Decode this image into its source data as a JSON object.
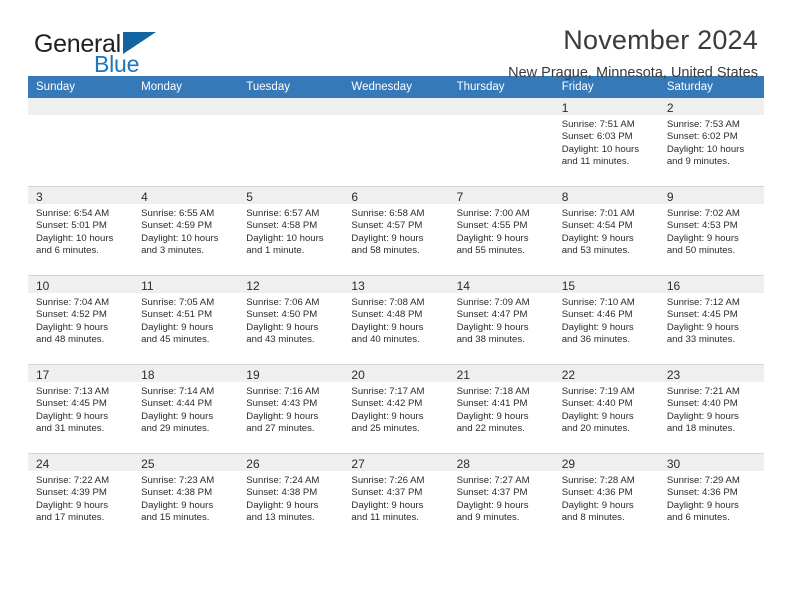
{
  "brand": {
    "name_top": "General",
    "name_bottom": "Blue",
    "accent_color": "#1b76bc",
    "triangle_color": "#12659f"
  },
  "header": {
    "title": "November 2024",
    "subtitle": "New Prague, Minnesota, United States",
    "header_bg": "#3579b9",
    "daystrip_bg": "#efefef"
  },
  "weekday_headers": [
    "Sunday",
    "Monday",
    "Tuesday",
    "Wednesday",
    "Thursday",
    "Friday",
    "Saturday"
  ],
  "weeks": [
    [
      {
        "day": "",
        "sunrise": "",
        "sunset": "",
        "daylight_1": "",
        "daylight_2": ""
      },
      {
        "day": "",
        "sunrise": "",
        "sunset": "",
        "daylight_1": "",
        "daylight_2": ""
      },
      {
        "day": "",
        "sunrise": "",
        "sunset": "",
        "daylight_1": "",
        "daylight_2": ""
      },
      {
        "day": "",
        "sunrise": "",
        "sunset": "",
        "daylight_1": "",
        "daylight_2": ""
      },
      {
        "day": "",
        "sunrise": "",
        "sunset": "",
        "daylight_1": "",
        "daylight_2": ""
      },
      {
        "day": "1",
        "sunrise": "Sunrise: 7:51 AM",
        "sunset": "Sunset: 6:03 PM",
        "daylight_1": "Daylight: 10 hours",
        "daylight_2": "and 11 minutes."
      },
      {
        "day": "2",
        "sunrise": "Sunrise: 7:53 AM",
        "sunset": "Sunset: 6:02 PM",
        "daylight_1": "Daylight: 10 hours",
        "daylight_2": "and 9 minutes."
      }
    ],
    [
      {
        "day": "3",
        "sunrise": "Sunrise: 6:54 AM",
        "sunset": "Sunset: 5:01 PM",
        "daylight_1": "Daylight: 10 hours",
        "daylight_2": "and 6 minutes."
      },
      {
        "day": "4",
        "sunrise": "Sunrise: 6:55 AM",
        "sunset": "Sunset: 4:59 PM",
        "daylight_1": "Daylight: 10 hours",
        "daylight_2": "and 3 minutes."
      },
      {
        "day": "5",
        "sunrise": "Sunrise: 6:57 AM",
        "sunset": "Sunset: 4:58 PM",
        "daylight_1": "Daylight: 10 hours",
        "daylight_2": "and 1 minute."
      },
      {
        "day": "6",
        "sunrise": "Sunrise: 6:58 AM",
        "sunset": "Sunset: 4:57 PM",
        "daylight_1": "Daylight: 9 hours",
        "daylight_2": "and 58 minutes."
      },
      {
        "day": "7",
        "sunrise": "Sunrise: 7:00 AM",
        "sunset": "Sunset: 4:55 PM",
        "daylight_1": "Daylight: 9 hours",
        "daylight_2": "and 55 minutes."
      },
      {
        "day": "8",
        "sunrise": "Sunrise: 7:01 AM",
        "sunset": "Sunset: 4:54 PM",
        "daylight_1": "Daylight: 9 hours",
        "daylight_2": "and 53 minutes."
      },
      {
        "day": "9",
        "sunrise": "Sunrise: 7:02 AM",
        "sunset": "Sunset: 4:53 PM",
        "daylight_1": "Daylight: 9 hours",
        "daylight_2": "and 50 minutes."
      }
    ],
    [
      {
        "day": "10",
        "sunrise": "Sunrise: 7:04 AM",
        "sunset": "Sunset: 4:52 PM",
        "daylight_1": "Daylight: 9 hours",
        "daylight_2": "and 48 minutes."
      },
      {
        "day": "11",
        "sunrise": "Sunrise: 7:05 AM",
        "sunset": "Sunset: 4:51 PM",
        "daylight_1": "Daylight: 9 hours",
        "daylight_2": "and 45 minutes."
      },
      {
        "day": "12",
        "sunrise": "Sunrise: 7:06 AM",
        "sunset": "Sunset: 4:50 PM",
        "daylight_1": "Daylight: 9 hours",
        "daylight_2": "and 43 minutes."
      },
      {
        "day": "13",
        "sunrise": "Sunrise: 7:08 AM",
        "sunset": "Sunset: 4:48 PM",
        "daylight_1": "Daylight: 9 hours",
        "daylight_2": "and 40 minutes."
      },
      {
        "day": "14",
        "sunrise": "Sunrise: 7:09 AM",
        "sunset": "Sunset: 4:47 PM",
        "daylight_1": "Daylight: 9 hours",
        "daylight_2": "and 38 minutes."
      },
      {
        "day": "15",
        "sunrise": "Sunrise: 7:10 AM",
        "sunset": "Sunset: 4:46 PM",
        "daylight_1": "Daylight: 9 hours",
        "daylight_2": "and 36 minutes."
      },
      {
        "day": "16",
        "sunrise": "Sunrise: 7:12 AM",
        "sunset": "Sunset: 4:45 PM",
        "daylight_1": "Daylight: 9 hours",
        "daylight_2": "and 33 minutes."
      }
    ],
    [
      {
        "day": "17",
        "sunrise": "Sunrise: 7:13 AM",
        "sunset": "Sunset: 4:45 PM",
        "daylight_1": "Daylight: 9 hours",
        "daylight_2": "and 31 minutes."
      },
      {
        "day": "18",
        "sunrise": "Sunrise: 7:14 AM",
        "sunset": "Sunset: 4:44 PM",
        "daylight_1": "Daylight: 9 hours",
        "daylight_2": "and 29 minutes."
      },
      {
        "day": "19",
        "sunrise": "Sunrise: 7:16 AM",
        "sunset": "Sunset: 4:43 PM",
        "daylight_1": "Daylight: 9 hours",
        "daylight_2": "and 27 minutes."
      },
      {
        "day": "20",
        "sunrise": "Sunrise: 7:17 AM",
        "sunset": "Sunset: 4:42 PM",
        "daylight_1": "Daylight: 9 hours",
        "daylight_2": "and 25 minutes."
      },
      {
        "day": "21",
        "sunrise": "Sunrise: 7:18 AM",
        "sunset": "Sunset: 4:41 PM",
        "daylight_1": "Daylight: 9 hours",
        "daylight_2": "and 22 minutes."
      },
      {
        "day": "22",
        "sunrise": "Sunrise: 7:19 AM",
        "sunset": "Sunset: 4:40 PM",
        "daylight_1": "Daylight: 9 hours",
        "daylight_2": "and 20 minutes."
      },
      {
        "day": "23",
        "sunrise": "Sunrise: 7:21 AM",
        "sunset": "Sunset: 4:40 PM",
        "daylight_1": "Daylight: 9 hours",
        "daylight_2": "and 18 minutes."
      }
    ],
    [
      {
        "day": "24",
        "sunrise": "Sunrise: 7:22 AM",
        "sunset": "Sunset: 4:39 PM",
        "daylight_1": "Daylight: 9 hours",
        "daylight_2": "and 17 minutes."
      },
      {
        "day": "25",
        "sunrise": "Sunrise: 7:23 AM",
        "sunset": "Sunset: 4:38 PM",
        "daylight_1": "Daylight: 9 hours",
        "daylight_2": "and 15 minutes."
      },
      {
        "day": "26",
        "sunrise": "Sunrise: 7:24 AM",
        "sunset": "Sunset: 4:38 PM",
        "daylight_1": "Daylight: 9 hours",
        "daylight_2": "and 13 minutes."
      },
      {
        "day": "27",
        "sunrise": "Sunrise: 7:26 AM",
        "sunset": "Sunset: 4:37 PM",
        "daylight_1": "Daylight: 9 hours",
        "daylight_2": "and 11 minutes."
      },
      {
        "day": "28",
        "sunrise": "Sunrise: 7:27 AM",
        "sunset": "Sunset: 4:37 PM",
        "daylight_1": "Daylight: 9 hours",
        "daylight_2": "and 9 minutes."
      },
      {
        "day": "29",
        "sunrise": "Sunrise: 7:28 AM",
        "sunset": "Sunset: 4:36 PM",
        "daylight_1": "Daylight: 9 hours",
        "daylight_2": "and 8 minutes."
      },
      {
        "day": "30",
        "sunrise": "Sunrise: 7:29 AM",
        "sunset": "Sunset: 4:36 PM",
        "daylight_1": "Daylight: 9 hours",
        "daylight_2": "and 6 minutes."
      }
    ]
  ]
}
